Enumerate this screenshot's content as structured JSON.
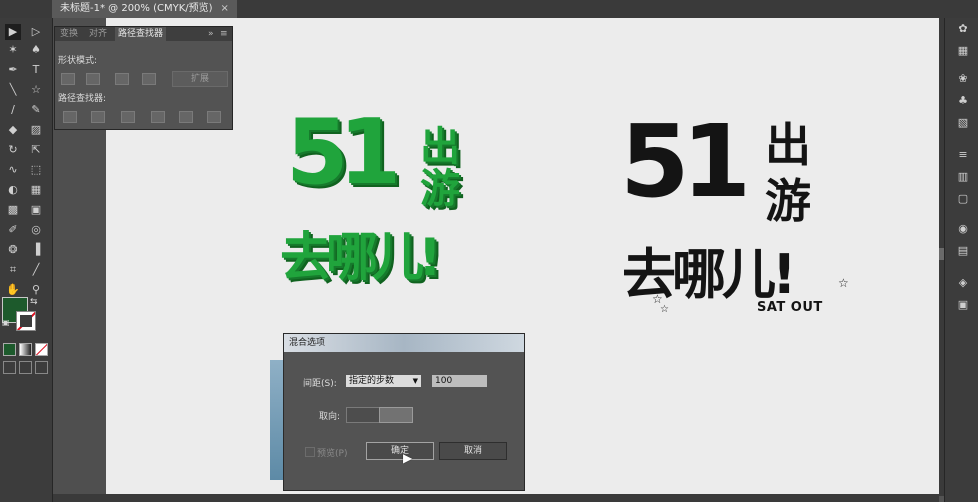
{
  "document": {
    "tab_title": "未标题-1* @ 200% (CMYK/预览)",
    "close_symbol": "×"
  },
  "pathfinder_panel": {
    "tabs": [
      "变换",
      "对齐",
      "路径查找器"
    ],
    "shape_modes_label": "形状模式:",
    "pathfinders_label": "路径查找器:",
    "expand_label": "扩展"
  },
  "artwork": {
    "green_51": "51",
    "green_chu_you": "出游",
    "green_qu_nar": "去哪儿!",
    "black_51": "51",
    "black_chu": "出",
    "black_you": "游",
    "black_qu_nar": "去哪儿!",
    "black_slogan": "SAT OUT",
    "colors": {
      "green": "#20a43c",
      "black": "#141414"
    }
  },
  "blend_dialog": {
    "title": "混合选项",
    "spacing_label": "间距(S):",
    "spacing_value": "指定的步数",
    "steps_value": "100",
    "orientation_label": "取向:",
    "preview_label": "预览(P)",
    "ok_label": "确定",
    "cancel_label": "取消"
  },
  "colors": {
    "fill": "#1d5a2c",
    "ui_bg": "#535353",
    "artboard": "#ececec"
  }
}
